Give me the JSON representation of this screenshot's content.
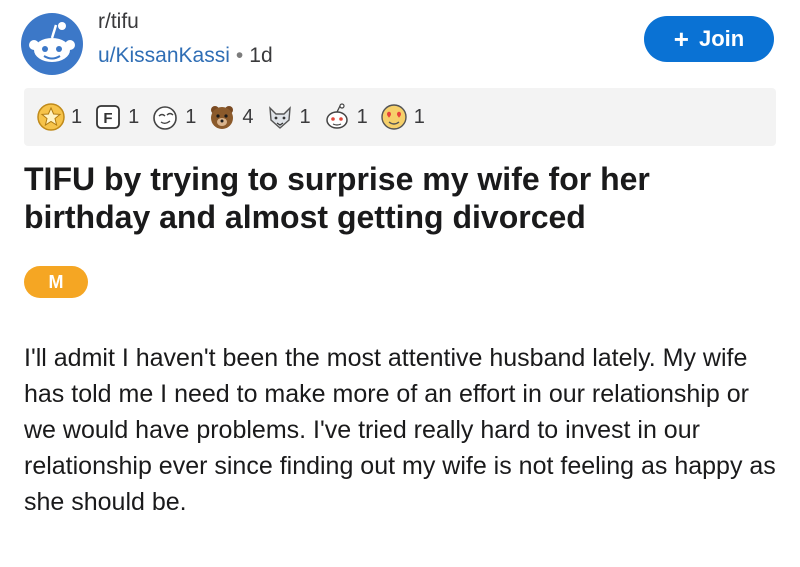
{
  "post": {
    "subreddit": "r/tifu",
    "author": "u/KissanKassi",
    "separator": "•",
    "age": "1d",
    "join_label": "Join",
    "join_icon": "+",
    "title": "TIFU by trying to surprise my wife for her birthday and almost getting divorced",
    "flair": "M",
    "body": "I'll admit I haven't been the most attentive husband lately. My wife has told me I need to make more of an effort in our relationship or we would have problems. I've tried really hard to invest in our relationship ever since finding out my wife is not feeling as happy as she should be."
  },
  "awards": [
    {
      "icon": "gold-star-award-icon",
      "count": "1"
    },
    {
      "icon": "f-press-award-icon",
      "count": "1"
    },
    {
      "icon": "doge-face-award-icon",
      "count": "1"
    },
    {
      "icon": "bear-award-icon",
      "count": "4"
    },
    {
      "icon": "wolf-award-icon",
      "count": "1"
    },
    {
      "icon": "snoo-face-award-icon",
      "count": "1"
    },
    {
      "icon": "heart-eyes-award-icon",
      "count": "1"
    }
  ],
  "colors": {
    "join_button": "#0a72d4",
    "username": "#2f6eb5",
    "flair": "#f5a623",
    "subreddit_avatar": "#3c78c8",
    "awards_bar": "#f3f3f3"
  }
}
